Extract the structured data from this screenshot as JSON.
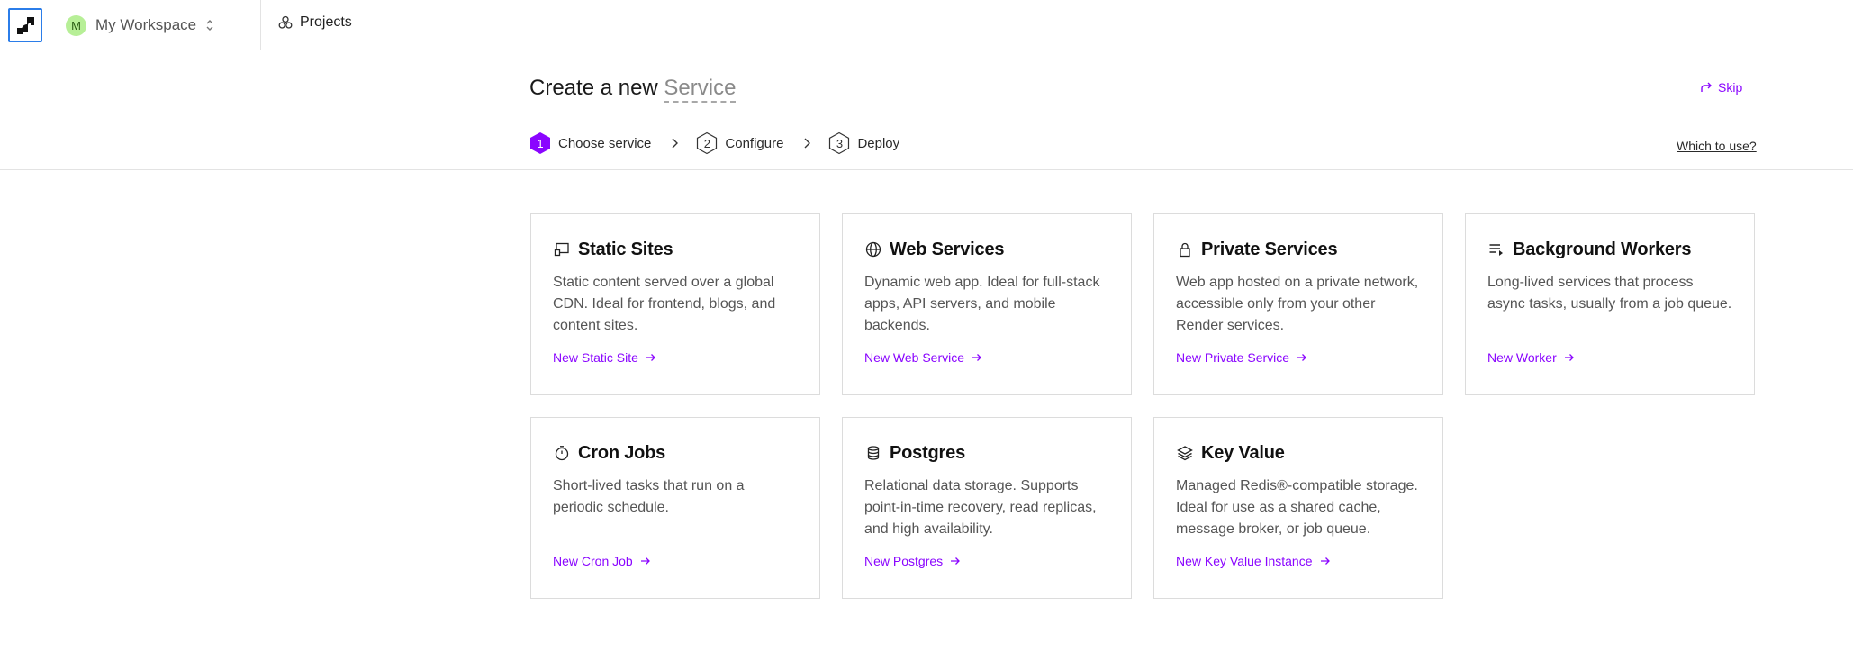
{
  "topbar": {
    "workspace_initial": "M",
    "workspace_name": "My Workspace",
    "projects_label": "Projects"
  },
  "header": {
    "title_prefix": "Create a new ",
    "title_accent": "Service",
    "skip_label": "Skip",
    "which_to_use": "Which to use?"
  },
  "steps": [
    {
      "number": "1",
      "label": "Choose service",
      "active": true
    },
    {
      "number": "2",
      "label": "Configure",
      "active": false
    },
    {
      "number": "3",
      "label": "Deploy",
      "active": false
    }
  ],
  "cards": [
    {
      "icon": "static-site-icon",
      "title": "Static Sites",
      "description": "Static content served over a global CDN. Ideal for frontend, blogs, and content sites.",
      "link": "New Static Site"
    },
    {
      "icon": "globe-icon",
      "title": "Web Services",
      "description": "Dynamic web app. Ideal for full-stack apps, API servers, and mobile backends.",
      "link": "New Web Service"
    },
    {
      "icon": "lock-icon",
      "title": "Private Services",
      "description": "Web app hosted on a private network, accessible only from your other Render services.",
      "link": "New Private Service"
    },
    {
      "icon": "queue-icon",
      "title": "Background Workers",
      "description": "Long-lived services that process async tasks, usually from a job queue.",
      "link": "New Worker"
    },
    {
      "icon": "timer-icon",
      "title": "Cron Jobs",
      "description": "Short-lived tasks that run on a periodic schedule.",
      "link": "New Cron Job"
    },
    {
      "icon": "database-icon",
      "title": "Postgres",
      "description": "Relational data storage. Supports point-in-time recovery, read replicas, and high availability.",
      "link": "New Postgres"
    },
    {
      "icon": "layers-icon",
      "title": "Key Value",
      "description": "Managed Redis®-compatible storage. Ideal for use as a shared cache, message broker, or job queue.",
      "link": "New Key Value Instance"
    }
  ],
  "colors": {
    "accent": "#8a05ff",
    "logo_border": "#2b7de9",
    "avatar_bg": "#b7ef97"
  }
}
